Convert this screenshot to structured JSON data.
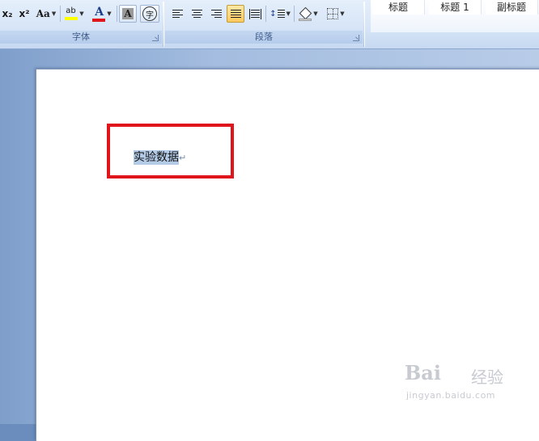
{
  "ribbon": {
    "font_group": {
      "label": "字体",
      "subscript": "x₂",
      "superscript": "x²",
      "change_case": "Aa",
      "highlight": "ab",
      "font_color": "A",
      "char_shading": "A",
      "enclose_char": "字"
    },
    "paragraph_group": {
      "label": "段落"
    },
    "styles_group": {
      "items": [
        "标题",
        "标题 1",
        "副标题"
      ]
    }
  },
  "document": {
    "text": "实验数据",
    "paragraph_mark": "↵"
  },
  "watermark": {
    "brand": "Bai",
    "brand2": "经验",
    "url": "jingyan.baidu.com"
  },
  "colors": {
    "highlight_yellow": "#ffff00",
    "font_red": "#e0151b",
    "annotation_red": "#e0151b",
    "selection": "#b4cbe8"
  }
}
